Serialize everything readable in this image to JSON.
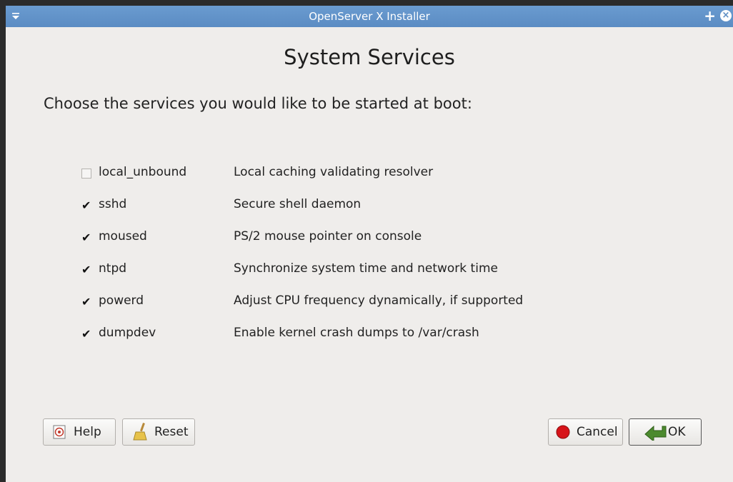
{
  "window": {
    "title": "OpenServer X Installer",
    "plus_glyph": "+",
    "close_glyph": "×"
  },
  "page": {
    "heading": "System Services",
    "subheading": "Choose the services you would like to be started at boot:"
  },
  "services": [
    {
      "name": "local_unbound",
      "description": "Local caching validating resolver",
      "checked": false
    },
    {
      "name": "sshd",
      "description": "Secure shell daemon",
      "checked": true
    },
    {
      "name": "moused",
      "description": "PS/2 mouse pointer on console",
      "checked": true
    },
    {
      "name": "ntpd",
      "description": "Synchronize system time and network time",
      "checked": true
    },
    {
      "name": "powerd",
      "description": "Adjust CPU frequency dynamically, if supported",
      "checked": true
    },
    {
      "name": "dumpdev",
      "description": "Enable kernel crash dumps to /var/crash",
      "checked": true
    }
  ],
  "checkmark_glyph": "✔",
  "buttons": {
    "help": {
      "label": "Help",
      "icon": "help-icon"
    },
    "reset": {
      "label": "Reset",
      "icon": "broom-icon"
    },
    "cancel": {
      "label": "Cancel",
      "icon": "stop-icon"
    },
    "ok": {
      "label": "OK",
      "icon": "green-arrow-icon"
    }
  },
  "colors": {
    "titlebar": "#5b8cc3",
    "window_bg": "#efedeb",
    "cancel_icon": "#d7141a",
    "ok_icon": "#4c8a2e"
  }
}
